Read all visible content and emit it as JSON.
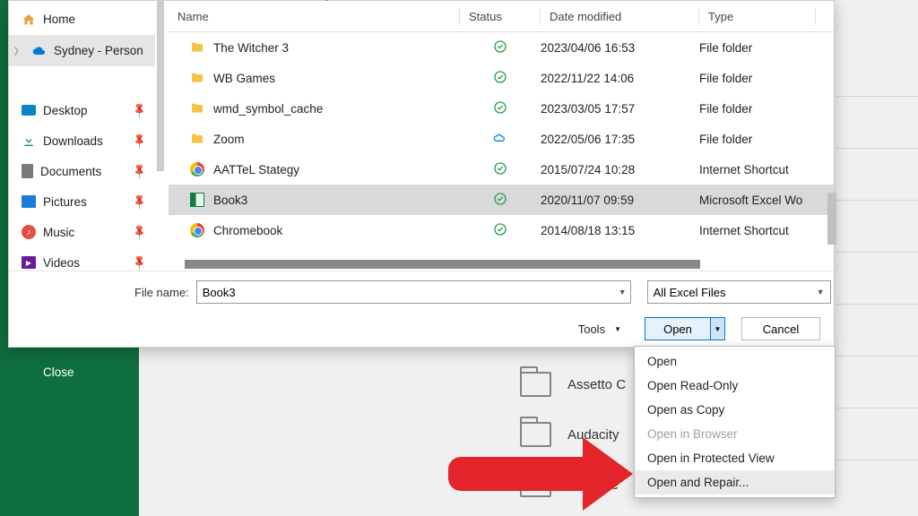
{
  "sidebar": {
    "home": "Home",
    "personal": "Sydney - Person",
    "desktop": "Desktop",
    "downloads": "Downloads",
    "documents": "Documents",
    "pictures": "Pictures",
    "music": "Music",
    "videos": "Videos"
  },
  "columns": {
    "name": "Name",
    "status": "Status",
    "date": "Date modified",
    "type": "Type"
  },
  "rows": [
    {
      "name": "The Witcher 3",
      "icon": "folder",
      "status": "check",
      "date": "2023/04/06 16:53",
      "type": "File folder"
    },
    {
      "name": "WB Games",
      "icon": "folder",
      "status": "check",
      "date": "2022/11/22 14:06",
      "type": "File folder"
    },
    {
      "name": "wmd_symbol_cache",
      "icon": "folder",
      "status": "check",
      "date": "2023/03/05 17:57",
      "type": "File folder"
    },
    {
      "name": "Zoom",
      "icon": "folder",
      "status": "cloud",
      "date": "2022/05/06 17:35",
      "type": "File folder"
    },
    {
      "name": "AATTeL Stategy",
      "icon": "chrome",
      "status": "check",
      "date": "2015/07/24 10:28",
      "type": "Internet Shortcut"
    },
    {
      "name": "Book3",
      "icon": "excel",
      "status": "check",
      "date": "2020/11/07 09:59",
      "type": "Microsoft Excel Wo",
      "selected": true
    },
    {
      "name": "Chromebook",
      "icon": "chrome",
      "status": "check",
      "date": "2014/08/18 13:15",
      "type": "Internet Shortcut"
    }
  ],
  "filename_label": "File name:",
  "filename_value": "Book3",
  "filetype_label": "All Excel Files",
  "tools_label": "Tools",
  "open_label": "Open",
  "cancel_label": "Cancel",
  "close_label": "Close",
  "dropdown": [
    "Open",
    "Open Read-Only",
    "Open as Copy",
    "Open in Browser",
    "Open in Protected View",
    "Open and Repair..."
  ],
  "bg_folders": [
    "Assetto C",
    "Audacity",
    "BioWare"
  ]
}
